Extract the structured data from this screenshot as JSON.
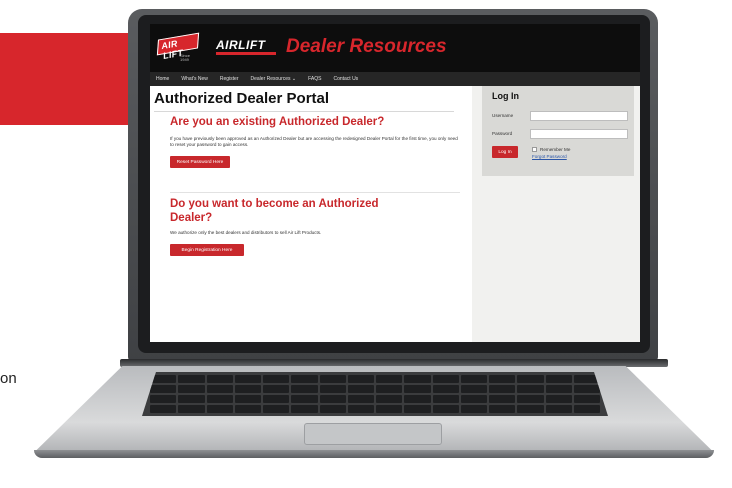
{
  "page": {
    "side_text": "on"
  },
  "site": {
    "logo_text": "AIR LIFT",
    "logo_since": "Since 1949",
    "brand_text": "AIRLIFT",
    "header_title": "Dealer Resources"
  },
  "nav": {
    "items": [
      "Home",
      "What's New",
      "Register",
      "Dealer Resources ⌄",
      "FAQS",
      "Contact Us"
    ]
  },
  "main": {
    "title": "Authorized Dealer Portal",
    "existing": {
      "heading": "Are you an existing Authorized Dealer?",
      "text": "If you have previously been approved as an Authorized Dealer but are accessing the redesigned Dealer Portal for the first time, you only need to reset your password to gain access.",
      "button": "Reset Password Here"
    },
    "become": {
      "heading": "Do you want to become an Authorized Dealer?",
      "text": "We authorize only the best dealers and distributors to sell Air Lift Products.",
      "button": "Begin Registration Here"
    }
  },
  "login": {
    "title": "Log In",
    "username_label": "Username",
    "password_label": "Password",
    "username_value": "",
    "password_value": "",
    "button": "Log In",
    "remember_label": "Remember Me",
    "forgot_link": "Forgot Password"
  },
  "colors": {
    "brand_red": "#d7262c",
    "header_black": "#0d0d0d",
    "nav_gray": "#262626",
    "sidebar_gray": "#d9d9d6",
    "link_blue": "#2b56a8"
  }
}
